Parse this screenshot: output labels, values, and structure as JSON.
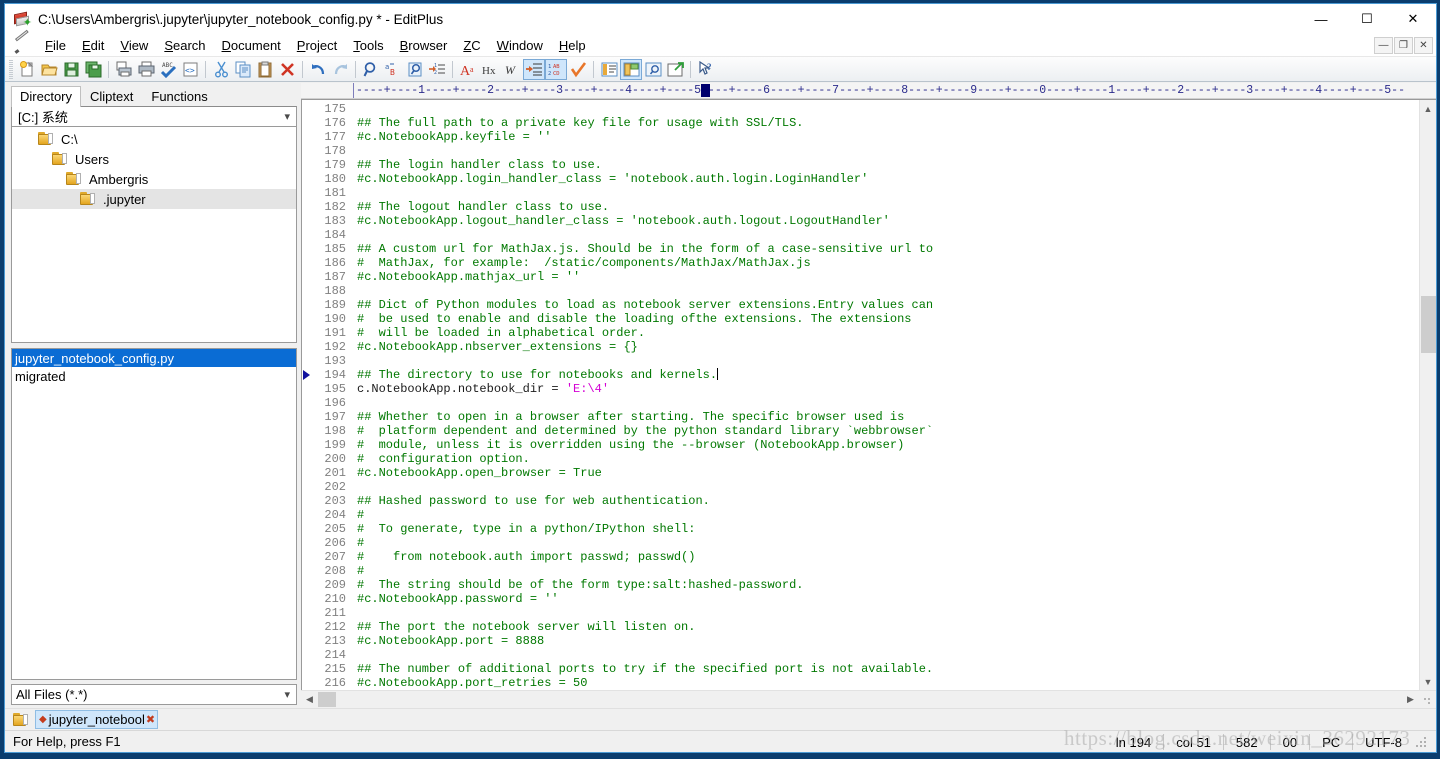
{
  "window": {
    "title": "C:\\Users\\Ambergris\\.jupyter\\jupyter_notebook_config.py * - EditPlus",
    "app_icon": "editplus-book-icon",
    "minimize": "—",
    "maximize": "☐",
    "close": "✕"
  },
  "menu": {
    "pencil_icon": "pencil-icon",
    "items": [
      {
        "label": "File",
        "accel": "F"
      },
      {
        "label": "Edit",
        "accel": "E"
      },
      {
        "label": "View",
        "accel": "V"
      },
      {
        "label": "Search",
        "accel": "S"
      },
      {
        "label": "Document",
        "accel": "D"
      },
      {
        "label": "Project",
        "accel": "P"
      },
      {
        "label": "Tools",
        "accel": "T"
      },
      {
        "label": "Browser",
        "accel": "B"
      },
      {
        "label": "ZC",
        "accel": "Z"
      },
      {
        "label": "Window",
        "accel": "W"
      },
      {
        "label": "Help",
        "accel": "H"
      }
    ],
    "mdi_buttons": [
      {
        "label": "—",
        "name": "mdi-minimize"
      },
      {
        "label": "❐",
        "name": "mdi-restore"
      },
      {
        "label": "✕",
        "name": "mdi-close"
      }
    ]
  },
  "toolbar": {
    "buttons": [
      {
        "name": "new-file-icon",
        "tip": "New"
      },
      {
        "name": "open-file-icon",
        "tip": "Open"
      },
      {
        "name": "save-icon",
        "tip": "Save"
      },
      {
        "name": "save-all-icon",
        "tip": "Save All"
      },
      {
        "name": "print-preview-icon",
        "tip": "Print Preview"
      },
      {
        "name": "print-icon",
        "tip": "Print"
      },
      {
        "name": "spell-check-icon",
        "tip": "Spell Check"
      },
      {
        "name": "view-source-icon",
        "tip": "View in Browser"
      },
      {
        "name": "cut-icon",
        "tip": "Cut"
      },
      {
        "name": "copy-icon",
        "tip": "Copy"
      },
      {
        "name": "paste-icon",
        "tip": "Paste"
      },
      {
        "name": "delete-icon",
        "tip": "Delete"
      },
      {
        "name": "undo-icon",
        "tip": "Undo"
      },
      {
        "name": "redo-icon",
        "tip": "Redo"
      },
      {
        "name": "find-icon",
        "tip": "Find"
      },
      {
        "name": "replace-icon",
        "tip": "Replace"
      },
      {
        "name": "find-in-files-icon",
        "tip": "Find in Files"
      },
      {
        "name": "goto-line-icon",
        "tip": "Go to Line"
      },
      {
        "name": "font-icon",
        "tip": "Font"
      },
      {
        "name": "hex-viewer-icon",
        "tip": "Hex Viewer"
      },
      {
        "name": "word-wrap-icon",
        "tip": "Word Wrap"
      },
      {
        "name": "indent-icon",
        "tip": "Indent",
        "active": true
      },
      {
        "name": "line-numbers-icon",
        "tip": "Line Numbers",
        "active": true
      },
      {
        "name": "check-icon",
        "tip": "Validate"
      },
      {
        "name": "output-window-icon",
        "tip": "Output Window"
      },
      {
        "name": "toggle-directory-icon",
        "tip": "Directory Window",
        "active": true
      },
      {
        "name": "document-selector-icon",
        "tip": "Document Selector"
      },
      {
        "name": "browser-preview-icon",
        "tip": "Preview in Browser"
      },
      {
        "name": "context-help-icon",
        "tip": "Context Help"
      }
    ]
  },
  "sidebar": {
    "tabs": [
      {
        "label": "Directory",
        "active": true
      },
      {
        "label": "Cliptext",
        "active": false
      },
      {
        "label": "Functions",
        "active": false
      }
    ],
    "drive_combo": {
      "value": "[C:] 系统",
      "arrow_icon": "chevron-down-icon"
    },
    "tree": [
      {
        "label": "C:\\",
        "depth": 0,
        "selected": false
      },
      {
        "label": "Users",
        "depth": 1,
        "selected": false
      },
      {
        "label": "Ambergris",
        "depth": 2,
        "selected": false
      },
      {
        "label": ".jupyter",
        "depth": 3,
        "selected": true
      }
    ],
    "files": [
      {
        "label": "jupyter_notebook_config.py",
        "selected": true
      },
      {
        "label": "migrated",
        "selected": false
      }
    ],
    "filter_combo": {
      "value": "All Files (*.*)",
      "arrow_icon": "chevron-down-icon"
    }
  },
  "editor": {
    "ruler_text": "----+----1----+----2----+----3----+----4----+----5----+----6----+----7----+----8----+----9----+----0----+----1----+----2----+----3----+----4----+----5--",
    "ruler_caret_col": 51,
    "first_line": 175,
    "bookmark_line": 194,
    "lines": [
      {
        "n": 175,
        "spans": []
      },
      {
        "n": 176,
        "spans": [
          {
            "t": "## The full path to a private key file for usage with SSL/TLS.",
            "c": "cm"
          }
        ]
      },
      {
        "n": 177,
        "spans": [
          {
            "t": "#c.NotebookApp.keyfile = ''",
            "c": "cm"
          }
        ]
      },
      {
        "n": 178,
        "spans": []
      },
      {
        "n": 179,
        "spans": [
          {
            "t": "## The login handler class to use.",
            "c": "cm"
          }
        ]
      },
      {
        "n": 180,
        "spans": [
          {
            "t": "#c.NotebookApp.login_handler_class = 'notebook.auth.login.LoginHandler'",
            "c": "cm"
          }
        ]
      },
      {
        "n": 181,
        "spans": []
      },
      {
        "n": 182,
        "spans": [
          {
            "t": "## The logout handler class to use.",
            "c": "cm"
          }
        ]
      },
      {
        "n": 183,
        "spans": [
          {
            "t": "#c.NotebookApp.logout_handler_class = 'notebook.auth.logout.LogoutHandler'",
            "c": "cm"
          }
        ]
      },
      {
        "n": 184,
        "spans": []
      },
      {
        "n": 185,
        "spans": [
          {
            "t": "## A custom url for MathJax.js. Should be in the form of a case-sensitive url to",
            "c": "cm"
          }
        ]
      },
      {
        "n": 186,
        "spans": [
          {
            "t": "#  MathJax, for example:  /static/components/MathJax/MathJax.js",
            "c": "cm"
          }
        ]
      },
      {
        "n": 187,
        "spans": [
          {
            "t": "#c.NotebookApp.mathjax_url = ''",
            "c": "cm"
          }
        ]
      },
      {
        "n": 188,
        "spans": []
      },
      {
        "n": 189,
        "spans": [
          {
            "t": "## Dict of Python modules to load as notebook server extensions.Entry values can",
            "c": "cm"
          }
        ]
      },
      {
        "n": 190,
        "spans": [
          {
            "t": "#  be used to enable and disable the loading ofthe extensions. The extensions",
            "c": "cm"
          }
        ]
      },
      {
        "n": 191,
        "spans": [
          {
            "t": "#  will be loaded in alphabetical order.",
            "c": "cm"
          }
        ]
      },
      {
        "n": 192,
        "spans": [
          {
            "t": "#c.NotebookApp.nbserver_extensions = {}",
            "c": "cm"
          }
        ]
      },
      {
        "n": 193,
        "spans": []
      },
      {
        "n": 194,
        "spans": [
          {
            "t": "## The directory to use for notebooks and kernels.",
            "c": "cm"
          }
        ],
        "caret_after": true
      },
      {
        "n": 195,
        "spans": [
          {
            "t": "c.NotebookApp.notebook_dir = ",
            "c": "num"
          },
          {
            "t": "'E:\\4'",
            "c": "str"
          }
        ]
      },
      {
        "n": 196,
        "spans": []
      },
      {
        "n": 197,
        "spans": [
          {
            "t": "## Whether to open in a browser after starting. The specific browser used is",
            "c": "cm"
          }
        ]
      },
      {
        "n": 198,
        "spans": [
          {
            "t": "#  platform dependent and determined by the python standard library `webbrowser`",
            "c": "cm"
          }
        ]
      },
      {
        "n": 199,
        "spans": [
          {
            "t": "#  module, unless it is overridden using the --browser (NotebookApp.browser)",
            "c": "cm"
          }
        ]
      },
      {
        "n": 200,
        "spans": [
          {
            "t": "#  configuration option.",
            "c": "cm"
          }
        ]
      },
      {
        "n": 201,
        "spans": [
          {
            "t": "#c.NotebookApp.open_browser = True",
            "c": "cm"
          }
        ]
      },
      {
        "n": 202,
        "spans": []
      },
      {
        "n": 203,
        "spans": [
          {
            "t": "## Hashed password to use for web authentication.",
            "c": "cm"
          }
        ]
      },
      {
        "n": 204,
        "spans": [
          {
            "t": "#",
            "c": "cm"
          }
        ]
      },
      {
        "n": 205,
        "spans": [
          {
            "t": "#  To generate, type in a python/IPython shell:",
            "c": "cm"
          }
        ]
      },
      {
        "n": 206,
        "spans": [
          {
            "t": "#",
            "c": "cm"
          }
        ]
      },
      {
        "n": 207,
        "spans": [
          {
            "t": "#    from notebook.auth import passwd; passwd()",
            "c": "cm"
          }
        ]
      },
      {
        "n": 208,
        "spans": [
          {
            "t": "#",
            "c": "cm"
          }
        ]
      },
      {
        "n": 209,
        "spans": [
          {
            "t": "#  The string should be of the form type:salt:hashed-password.",
            "c": "cm"
          }
        ]
      },
      {
        "n": 210,
        "spans": [
          {
            "t": "#c.NotebookApp.password = ''",
            "c": "cm"
          }
        ]
      },
      {
        "n": 211,
        "spans": []
      },
      {
        "n": 212,
        "spans": [
          {
            "t": "## The port the notebook server will listen on.",
            "c": "cm"
          }
        ]
      },
      {
        "n": 213,
        "spans": [
          {
            "t": "#c.NotebookApp.port = 8888",
            "c": "cm"
          }
        ]
      },
      {
        "n": 214,
        "spans": []
      },
      {
        "n": 215,
        "spans": [
          {
            "t": "## The number of additional ports to try if the specified port is not available.",
            "c": "cm"
          }
        ]
      },
      {
        "n": 216,
        "spans": [
          {
            "t": "#c.NotebookApp.port_retries = 50",
            "c": "cm"
          }
        ]
      }
    ],
    "scroll_up_icon": "chevron-up-icon",
    "scroll_down_icon": "chevron-down-icon",
    "scroll_left_icon": "chevron-left-icon",
    "scroll_right_icon": "chevron-right-icon"
  },
  "doc_tabs": {
    "folder_icon": "folder-icon",
    "tabs": [
      {
        "label": "jupyter_notebool",
        "dirty": true,
        "close_icon": "close-icon",
        "active": true
      }
    ]
  },
  "status": {
    "help_text": "For Help, press F1",
    "cells": [
      {
        "name": "line-indicator",
        "value": "ln 194"
      },
      {
        "name": "column-indicator",
        "value": "col 51"
      },
      {
        "name": "char-offset",
        "value": "582"
      },
      {
        "name": "sel-count",
        "value": "00"
      },
      {
        "name": "line-ending",
        "value": "PC"
      },
      {
        "name": "encoding",
        "value": "UTF-8"
      }
    ],
    "grip_icon": "resize-grip-icon"
  },
  "watermark": {
    "text": "https://blog.csdn.net/weixin_36292173"
  },
  "colors": {
    "comment_green": "#007800",
    "string_magenta": "#d400d4",
    "selection_blue": "#0a6cd4",
    "ruler_blue": "#2b2b8c",
    "desktop_blue": "#0a3d6e"
  }
}
